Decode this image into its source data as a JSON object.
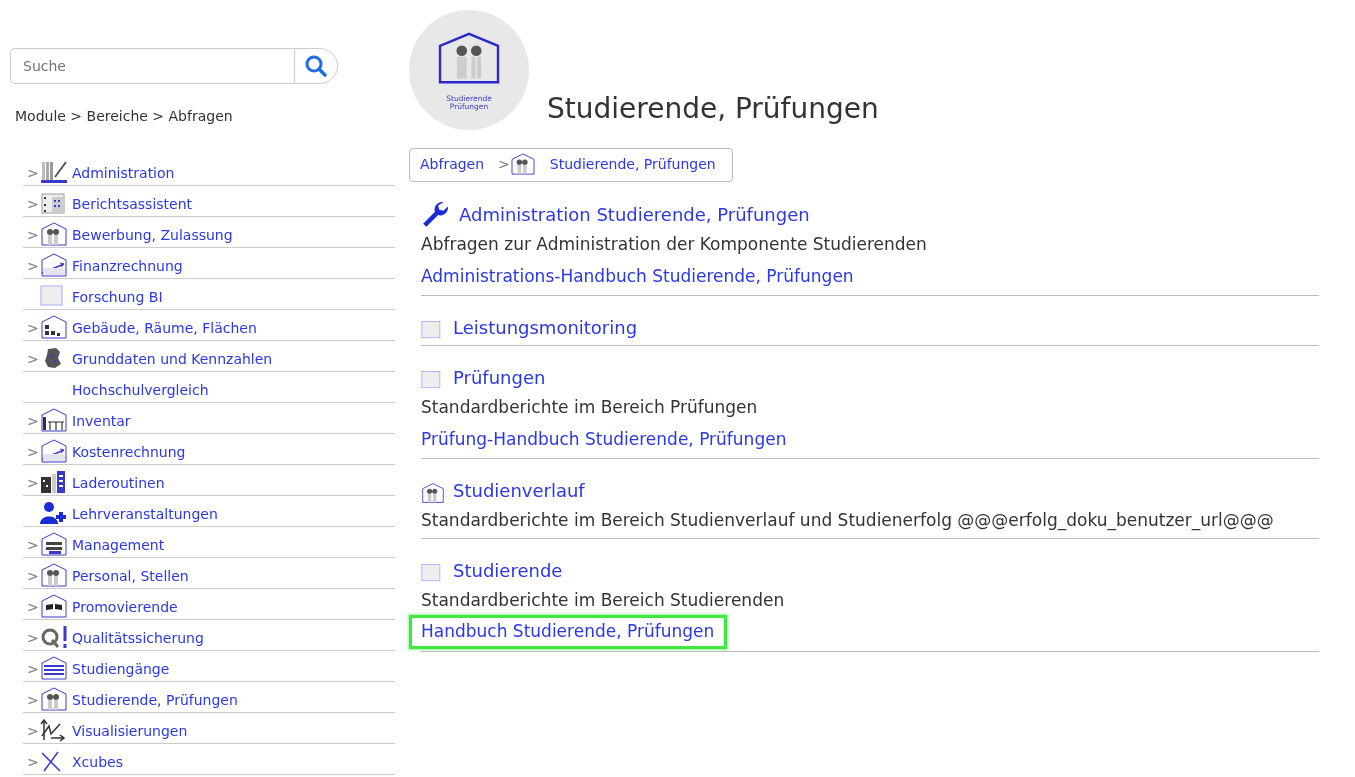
{
  "search": {
    "placeholder": "Suche"
  },
  "sidebar": {
    "breadcrumb": "Module > Bereiche > Abfragen",
    "items": [
      {
        "label": "Administration",
        "marker": ">",
        "kind": "bars"
      },
      {
        "label": "Berichtsassistent",
        "marker": ">",
        "kind": "grid"
      },
      {
        "label": "Bewerbung, Zulassung",
        "marker": ">",
        "kind": "house-people"
      },
      {
        "label": "Finanzrechnung",
        "marker": ">",
        "kind": "house-arrow"
      },
      {
        "label": "Forschung BI",
        "kind": "square"
      },
      {
        "label": "Gebäude, Räume, Flächen",
        "marker": ">",
        "kind": "house-blocks"
      },
      {
        "label": "Grunddaten und Kennzahlen",
        "marker": ">",
        "kind": "map"
      },
      {
        "label": "Hochschulvergleich",
        "kind": "plain"
      },
      {
        "label": "Inventar",
        "marker": ">",
        "kind": "house-furniture"
      },
      {
        "label": "Kostenrechnung",
        "marker": ">",
        "kind": "house-arrow"
      },
      {
        "label": "Laderoutinen",
        "marker": ">",
        "kind": "buildings"
      },
      {
        "label": "Lehrveranstaltungen",
        "kind": "person-plus"
      },
      {
        "label": "Management",
        "marker": ">",
        "kind": "house-grid"
      },
      {
        "label": "Personal, Stellen",
        "marker": ">",
        "kind": "house-people"
      },
      {
        "label": "Promovierende",
        "marker": ">",
        "kind": "house-flags"
      },
      {
        "label": "Qualitätssicherung",
        "marker": ">",
        "kind": "qa"
      },
      {
        "label": "Studiengänge",
        "marker": ">",
        "kind": "house-lines"
      },
      {
        "label": "Studierende, Prüfungen",
        "marker": ">",
        "kind": "house-people"
      },
      {
        "label": "Visualisierungen",
        "marker": ">",
        "kind": "axes"
      },
      {
        "label": "Xcubes",
        "marker": ">",
        "kind": "cross"
      }
    ]
  },
  "logo": {
    "caption": [
      "Studierende",
      "Prüfungen"
    ]
  },
  "title": "Studierende, Prüfungen",
  "breadcrumb": {
    "items": [
      "Abfragen",
      "Studierende, Prüfungen"
    ],
    "separator": ">"
  },
  "sections": [
    {
      "kind": "wrench",
      "title": "Administration Studierende, Prüfungen",
      "description": "Abfragen zur Administration der Komponente Studierenden",
      "link": "Administrations-Handbuch Studierende, Prüfungen",
      "highlighted": false
    },
    {
      "kind": "square",
      "title": "Leistungsmonitoring"
    },
    {
      "kind": "square",
      "title": "Prüfungen",
      "description": "Standardberichte im Bereich Prüfungen",
      "link": "Prüfung-Handbuch Studierende, Prüfungen",
      "highlighted": false
    },
    {
      "kind": "house-people",
      "title": "Studienverlauf",
      "description": "Standardberichte im Bereich Studienverlauf und Studienerfolg @@@erfolg_doku_benutzer_url@@@"
    },
    {
      "kind": "square",
      "title": "Studierende",
      "description": "Standardberichte im Bereich Studierenden",
      "link": "Handbuch Studierende, Prüfungen",
      "highlighted": true
    }
  ]
}
